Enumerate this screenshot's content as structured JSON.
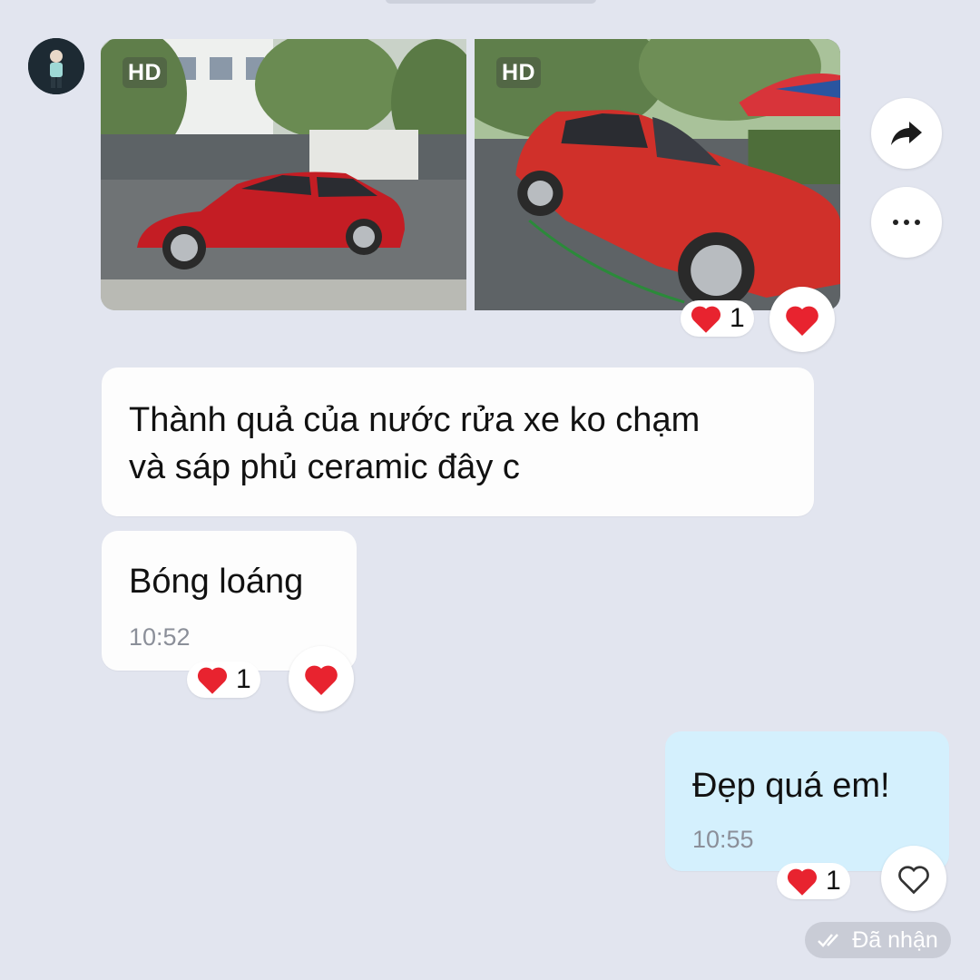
{
  "photos": [
    {
      "badge": "HD"
    },
    {
      "badge": "HD"
    }
  ],
  "photo_reaction": {
    "icon": "heart-icon",
    "count": "1"
  },
  "messages": [
    {
      "text": "Thành quả của nước rửa xe ko chạm\nvà sáp phủ ceramic đây c"
    },
    {
      "text": "Bóng loáng",
      "time": "10:52",
      "reaction_count": "1"
    },
    {
      "text": "Đẹp quá em!",
      "time": "10:55",
      "reaction_count": "1"
    }
  ],
  "status": {
    "label": "Đã nhận",
    "icon": "double-check-icon"
  },
  "colors": {
    "background": "#e2e5ef",
    "incoming_bubble": "#fdfdfd",
    "outgoing_bubble": "#d4f0fd",
    "heart": "#e8232f"
  }
}
